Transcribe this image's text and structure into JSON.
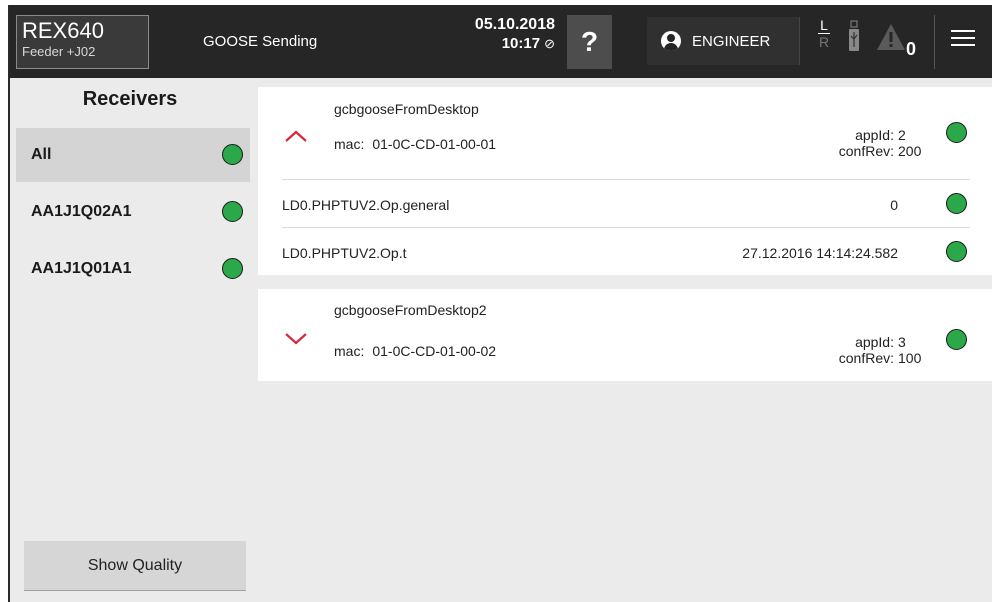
{
  "header": {
    "device_name": "REX640",
    "device_sub": "Feeder +J02",
    "app_title": "GOOSE Sending",
    "date": "05.10.2018",
    "time": "10:17",
    "clock_icon": "clock-sync-off-icon",
    "help_label": "?",
    "user_role": "ENGINEER",
    "local_label": "L",
    "remote_label": "R",
    "warning_count": "0"
  },
  "sidebar": {
    "title": "Receivers",
    "items": [
      {
        "label": "All",
        "status": "ok",
        "selected": true
      },
      {
        "label": "AA1J1Q02A1",
        "status": "ok",
        "selected": false
      },
      {
        "label": "AA1J1Q01A1",
        "status": "ok",
        "selected": false
      }
    ],
    "show_quality_label": "Show Quality"
  },
  "main": {
    "goose_blocks": [
      {
        "name": "gcbgooseFromDesktop",
        "expanded": true,
        "mac_label": "mac:",
        "mac": "01-0C-CD-01-00-01",
        "appid_label": "appId:",
        "appid": "2",
        "confrev_label": "confRev:",
        "confrev": "200",
        "signals": [
          {
            "name": "LD0.PHPTUV2.Op.general",
            "value": "0"
          },
          {
            "name": "LD0.PHPTUV2.Op.t",
            "value": "27.12.2016 14:14:24.582"
          }
        ]
      },
      {
        "name": "gcbgooseFromDesktop2",
        "expanded": false,
        "mac_label": "mac:",
        "mac": "01-0C-CD-01-00-02",
        "appid_label": "appId:",
        "appid": "3",
        "confrev_label": "confRev:",
        "confrev": "100",
        "signals": []
      }
    ]
  },
  "colors": {
    "status_ok": "#2aa84a",
    "accent_chevron": "#d8283c",
    "header_bg": "#262626"
  }
}
